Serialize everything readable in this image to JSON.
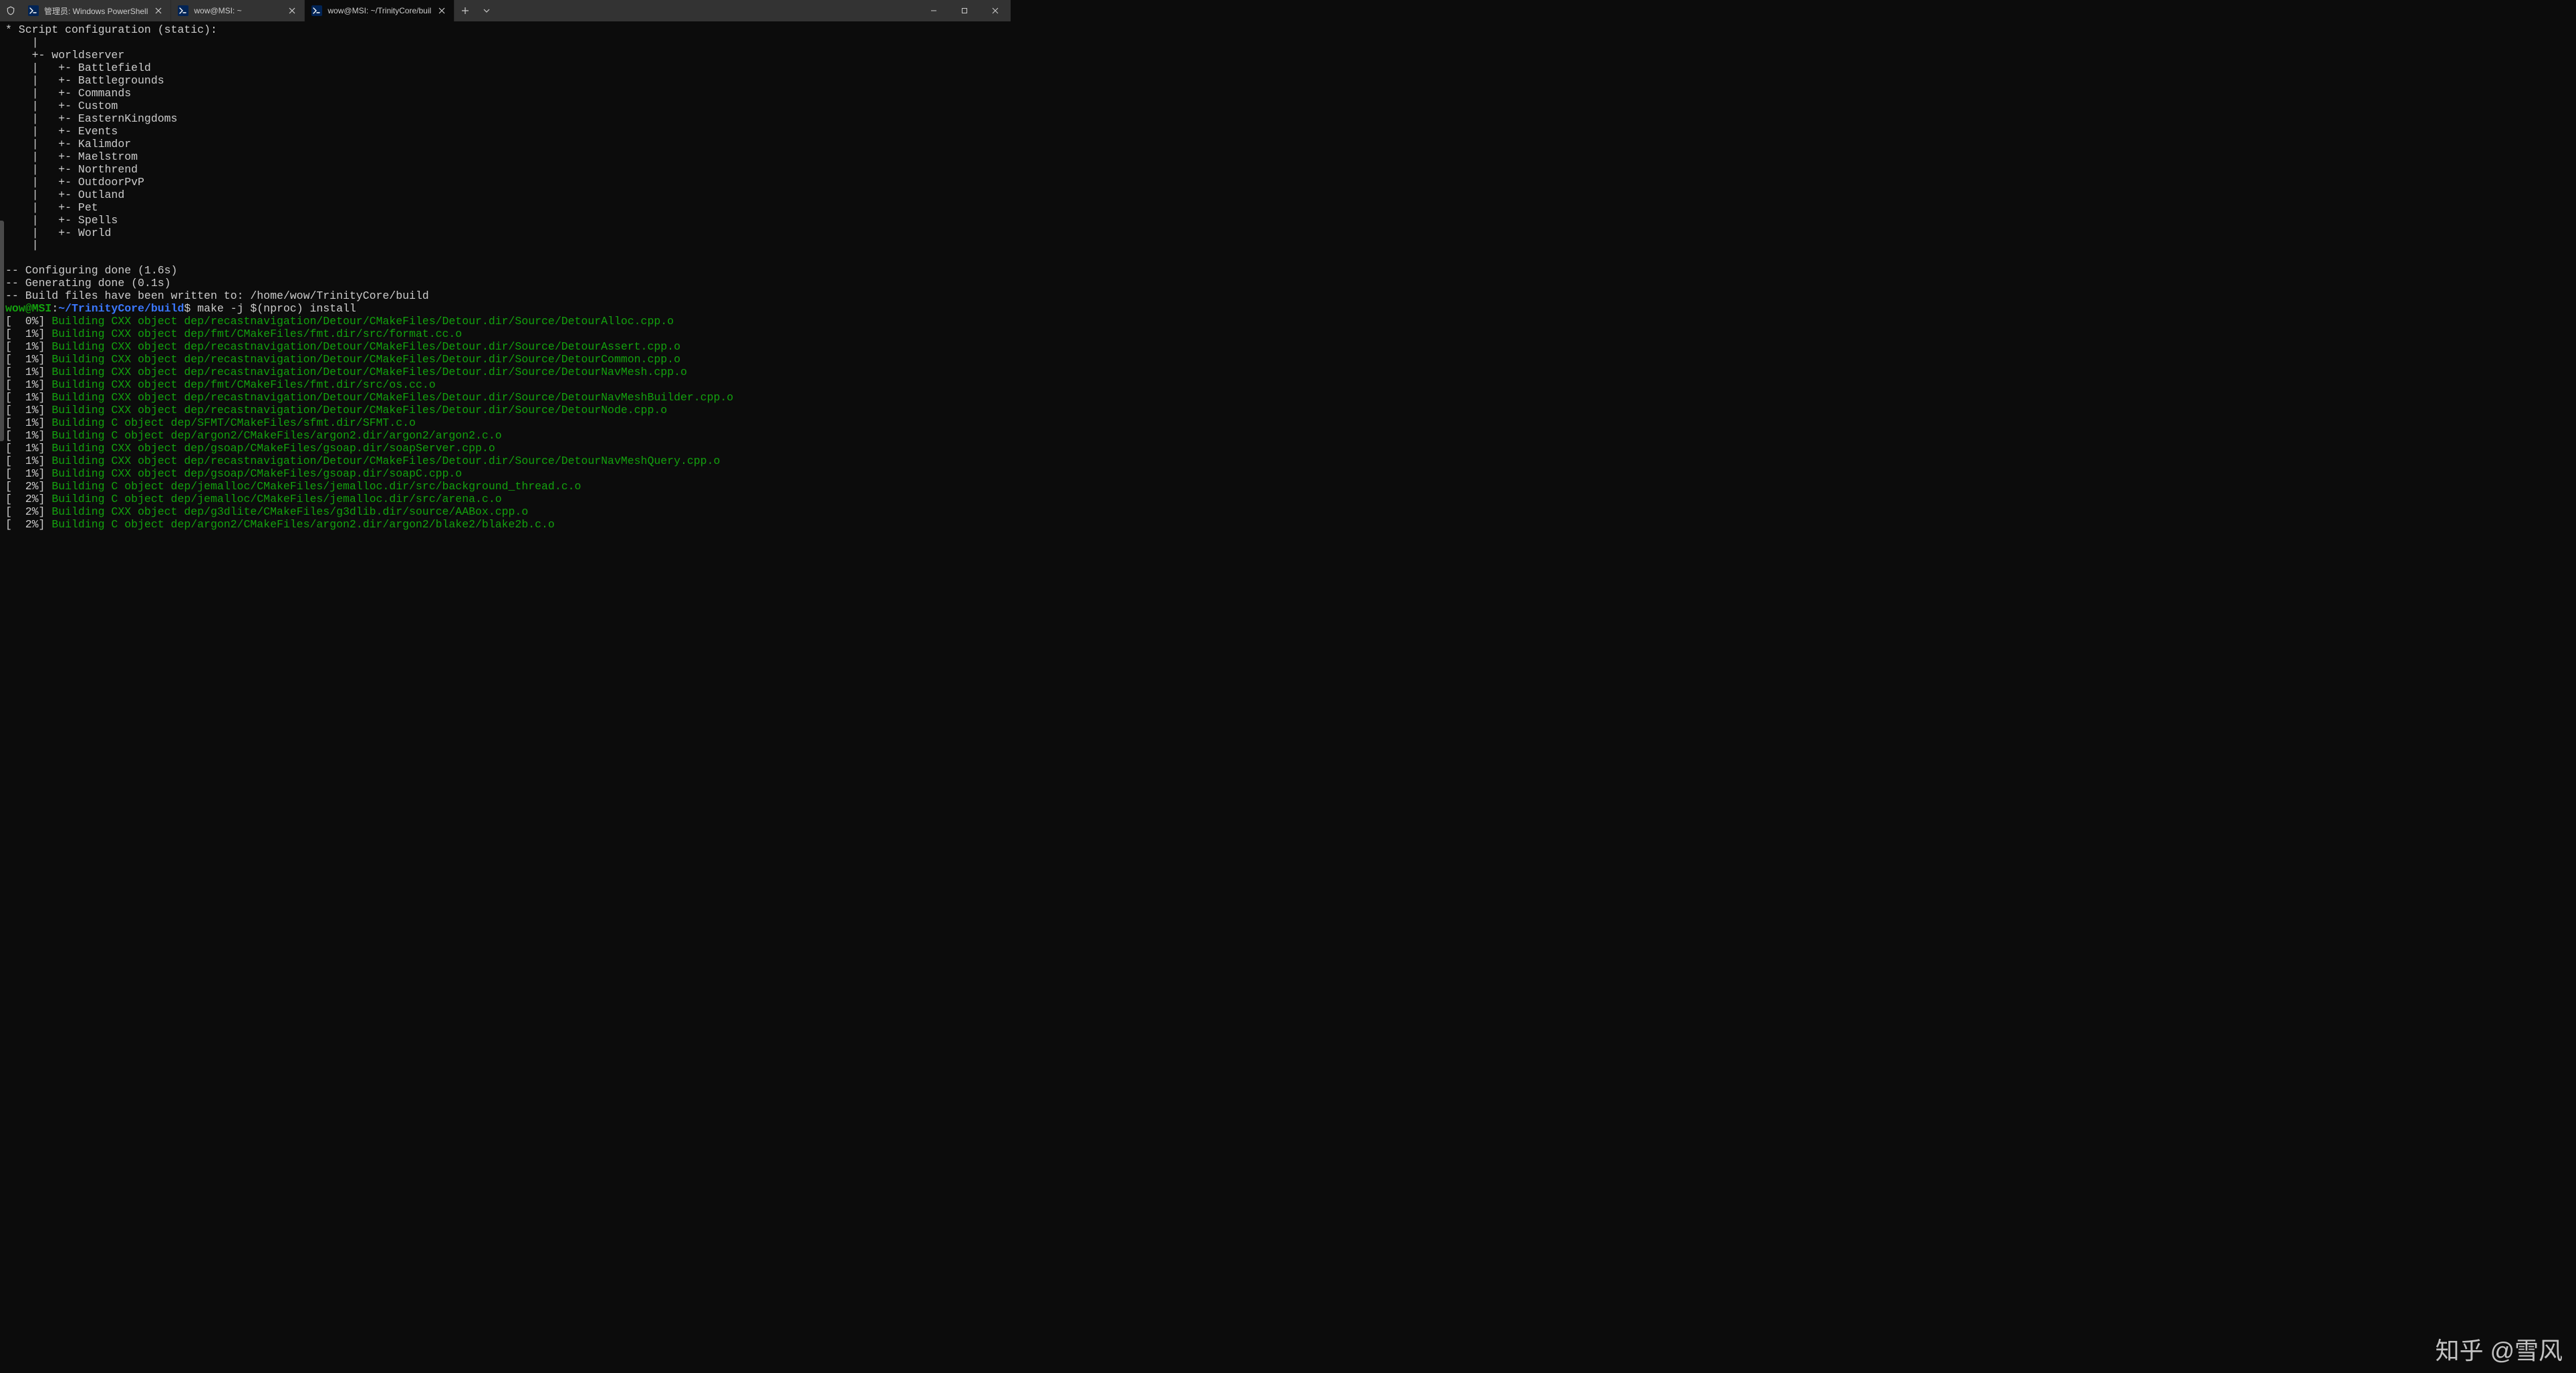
{
  "tabs": [
    {
      "title": "管理员: Windows PowerShell",
      "active": false
    },
    {
      "title": "wow@MSI: ~",
      "active": false
    },
    {
      "title": "wow@MSI: ~/TrinityCore/buil",
      "active": true
    }
  ],
  "script_config_header": "* Script configuration (static):",
  "tree": {
    "root": "worldserver",
    "children": [
      "Battlefield",
      "Battlegrounds",
      "Commands",
      "Custom",
      "EasternKingdoms",
      "Events",
      "Kalimdor",
      "Maelstrom",
      "Northrend",
      "OutdoorPvP",
      "Outland",
      "Pet",
      "Spells",
      "World"
    ]
  },
  "cmake": {
    "configuring": "-- Configuring done (1.6s)",
    "generating": "-- Generating done (0.1s)",
    "build_files": "-- Build files have been written to: /home/wow/TrinityCore/build"
  },
  "prompt": {
    "user_host": "wow@MSI",
    "colon": ":",
    "path": "~/TrinityCore/build",
    "dollar": "$",
    "command": "make -j $(nproc) install"
  },
  "build_lines": [
    {
      "pct": "0%",
      "text": "Building CXX object dep/recastnavigation/Detour/CMakeFiles/Detour.dir/Source/DetourAlloc.cpp.o"
    },
    {
      "pct": "1%",
      "text": "Building CXX object dep/fmt/CMakeFiles/fmt.dir/src/format.cc.o"
    },
    {
      "pct": "1%",
      "text": "Building CXX object dep/recastnavigation/Detour/CMakeFiles/Detour.dir/Source/DetourAssert.cpp.o"
    },
    {
      "pct": "1%",
      "text": "Building CXX object dep/recastnavigation/Detour/CMakeFiles/Detour.dir/Source/DetourCommon.cpp.o"
    },
    {
      "pct": "1%",
      "text": "Building CXX object dep/recastnavigation/Detour/CMakeFiles/Detour.dir/Source/DetourNavMesh.cpp.o"
    },
    {
      "pct": "1%",
      "text": "Building CXX object dep/fmt/CMakeFiles/fmt.dir/src/os.cc.o"
    },
    {
      "pct": "1%",
      "text": "Building CXX object dep/recastnavigation/Detour/CMakeFiles/Detour.dir/Source/DetourNavMeshBuilder.cpp.o"
    },
    {
      "pct": "1%",
      "text": "Building CXX object dep/recastnavigation/Detour/CMakeFiles/Detour.dir/Source/DetourNode.cpp.o"
    },
    {
      "pct": "1%",
      "text": "Building C object dep/SFMT/CMakeFiles/sfmt.dir/SFMT.c.o"
    },
    {
      "pct": "1%",
      "text": "Building C object dep/argon2/CMakeFiles/argon2.dir/argon2/argon2.c.o"
    },
    {
      "pct": "1%",
      "text": "Building CXX object dep/gsoap/CMakeFiles/gsoap.dir/soapServer.cpp.o"
    },
    {
      "pct": "1%",
      "text": "Building CXX object dep/recastnavigation/Detour/CMakeFiles/Detour.dir/Source/DetourNavMeshQuery.cpp.o"
    },
    {
      "pct": "1%",
      "text": "Building CXX object dep/gsoap/CMakeFiles/gsoap.dir/soapC.cpp.o"
    },
    {
      "pct": "2%",
      "text": "Building C object dep/jemalloc/CMakeFiles/jemalloc.dir/src/background_thread.c.o"
    },
    {
      "pct": "2%",
      "text": "Building C object dep/jemalloc/CMakeFiles/jemalloc.dir/src/arena.c.o"
    },
    {
      "pct": "2%",
      "text": "Building CXX object dep/g3dlite/CMakeFiles/g3dlib.dir/source/AABox.cpp.o"
    },
    {
      "pct": "2%",
      "text": "Building C object dep/argon2/CMakeFiles/argon2.dir/argon2/blake2/blake2b.c.o"
    }
  ],
  "watermark": "知乎 @雪风"
}
